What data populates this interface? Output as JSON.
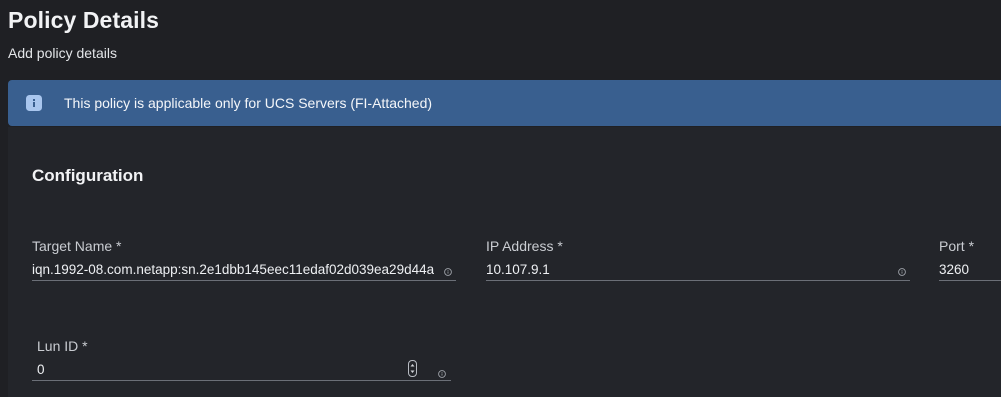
{
  "header": {
    "title": "Policy Details",
    "subtitle": "Add policy details"
  },
  "banner": {
    "icon": "info-icon",
    "text": "This policy is applicable only for UCS Servers (FI-Attached)",
    "color": "#395f8f"
  },
  "configuration": {
    "title": "Configuration",
    "fields": {
      "target_name": {
        "label": "Target Name *",
        "value": "iqn.1992-08.com.netapp:sn.2e1dbb145eec11edaf02d039ea29d44a"
      },
      "ip_address": {
        "label": "IP Address *",
        "value": "10.107.9.1"
      },
      "port": {
        "label": "Port *",
        "value": "3260"
      },
      "lun_id": {
        "label": "Lun ID *",
        "value": "0"
      }
    }
  }
}
